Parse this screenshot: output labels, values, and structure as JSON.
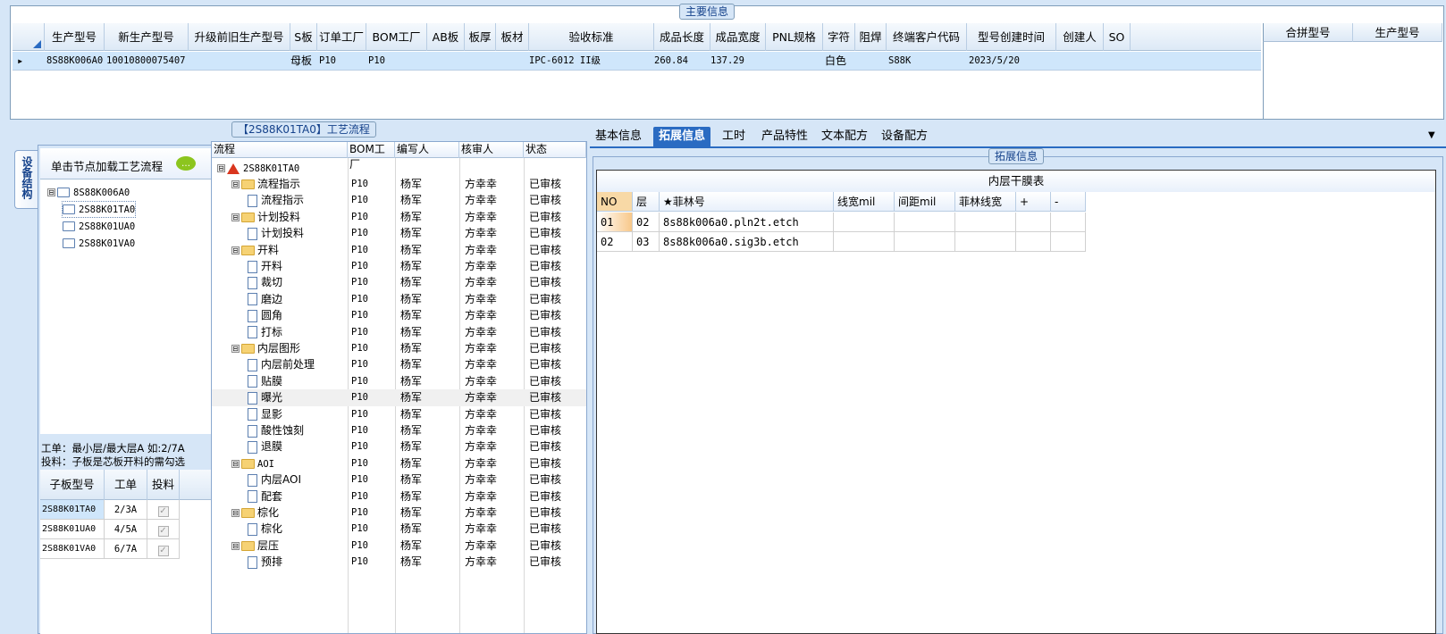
{
  "main_info": {
    "title": "主要信息",
    "headers": [
      "生产型号",
      "新生产型号",
      "升级前旧生产型号",
      "S板",
      "订单工厂",
      "BOM工厂",
      "AB板",
      "板厚",
      "板材",
      "验收标准",
      "成品长度",
      "成品宽度",
      "PNL规格",
      "字符",
      "阻焊",
      "终端客户代码",
      "型号创建时间",
      "创建人",
      "SO"
    ],
    "row": {
      "marker": "▸",
      "prod_model": "8S88K006A0",
      "new_model": "10010800075407",
      "old_model": "",
      "s_board": "母板",
      "order_factory": "P10",
      "bom_factory": "P10",
      "ab": "",
      "thickness": "",
      "material": "",
      "standard": "IPC-6012 II级",
      "length": "260.84",
      "width": "137.29",
      "pnl": "",
      "char": "白色",
      "mask": "",
      "customer": "S88K",
      "created": "2023/5/20",
      "creator": "",
      "so": ""
    },
    "merge_headers": [
      "合拼型号",
      "生产型号"
    ]
  },
  "left": {
    "vertical_tab": "设备结构",
    "click_hint": "单击节点加载工艺流程",
    "tree": [
      {
        "label": "8S88K006A0",
        "level": 0,
        "toggle": "⊟"
      },
      {
        "label": "2S88K01TA0",
        "level": 1,
        "selected": true
      },
      {
        "label": "2S88K01UA0",
        "level": 1
      },
      {
        "label": "2S88K01VA0",
        "level": 1
      }
    ],
    "note_line1": "工单：最小层/最大层A 如:2/7A",
    "note_line2": "投料：子板是芯板开料的需勾选",
    "sub_headers": [
      "子板型号",
      "工单",
      "投料"
    ],
    "sub_rows": [
      {
        "model": "2S88K01TA0",
        "order": "2/3A",
        "check": "✓"
      },
      {
        "model": "2S88K01UA0",
        "order": "4/5A",
        "check": "✓"
      },
      {
        "model": "2S88K01VA0",
        "order": "6/7A",
        "check": "✓"
      }
    ]
  },
  "process": {
    "title": "【2S88K01TA0】工艺流程",
    "headers": [
      "流程",
      "BOM工厂",
      "编写人",
      "核审人",
      "状态"
    ],
    "root": "2S88K01TA0",
    "rows": [
      {
        "name": "流程指示",
        "type": "group",
        "factory": "P10",
        "writer": "杨军",
        "reviewer": "方幸幸",
        "status": "已审核"
      },
      {
        "name": "流程指示",
        "type": "leaf",
        "factory": "P10",
        "writer": "杨军",
        "reviewer": "方幸幸",
        "status": "已审核"
      },
      {
        "name": "计划投料",
        "type": "group",
        "factory": "P10",
        "writer": "杨军",
        "reviewer": "方幸幸",
        "status": "已审核"
      },
      {
        "name": "计划投料",
        "type": "leaf",
        "factory": "P10",
        "writer": "杨军",
        "reviewer": "方幸幸",
        "status": "已审核"
      },
      {
        "name": "开料",
        "type": "group",
        "factory": "P10",
        "writer": "杨军",
        "reviewer": "方幸幸",
        "status": "已审核"
      },
      {
        "name": "开料",
        "type": "leaf",
        "factory": "P10",
        "writer": "杨军",
        "reviewer": "方幸幸",
        "status": "已审核"
      },
      {
        "name": "裁切",
        "type": "leaf",
        "factory": "P10",
        "writer": "杨军",
        "reviewer": "方幸幸",
        "status": "已审核"
      },
      {
        "name": "磨边",
        "type": "leaf",
        "factory": "P10",
        "writer": "杨军",
        "reviewer": "方幸幸",
        "status": "已审核"
      },
      {
        "name": "圆角",
        "type": "leaf",
        "factory": "P10",
        "writer": "杨军",
        "reviewer": "方幸幸",
        "status": "已审核"
      },
      {
        "name": "打标",
        "type": "leaf",
        "factory": "P10",
        "writer": "杨军",
        "reviewer": "方幸幸",
        "status": "已审核"
      },
      {
        "name": "内层图形",
        "type": "group",
        "factory": "P10",
        "writer": "杨军",
        "reviewer": "方幸幸",
        "status": "已审核"
      },
      {
        "name": "内层前处理",
        "type": "leaf",
        "factory": "P10",
        "writer": "杨军",
        "reviewer": "方幸幸",
        "status": "已审核"
      },
      {
        "name": "贴膜",
        "type": "leaf",
        "factory": "P10",
        "writer": "杨军",
        "reviewer": "方幸幸",
        "status": "已审核"
      },
      {
        "name": "曝光",
        "type": "leaf",
        "factory": "P10",
        "writer": "杨军",
        "reviewer": "方幸幸",
        "status": "已审核",
        "highlight": true
      },
      {
        "name": "显影",
        "type": "leaf",
        "factory": "P10",
        "writer": "杨军",
        "reviewer": "方幸幸",
        "status": "已审核"
      },
      {
        "name": "酸性蚀刻",
        "type": "leaf",
        "factory": "P10",
        "writer": "杨军",
        "reviewer": "方幸幸",
        "status": "已审核"
      },
      {
        "name": "退膜",
        "type": "leaf",
        "factory": "P10",
        "writer": "杨军",
        "reviewer": "方幸幸",
        "status": "已审核"
      },
      {
        "name": "AOI",
        "type": "group",
        "factory": "P10",
        "writer": "杨军",
        "reviewer": "方幸幸",
        "status": "已审核"
      },
      {
        "name": "内层AOI",
        "type": "leaf",
        "factory": "P10",
        "writer": "杨军",
        "reviewer": "方幸幸",
        "status": "已审核"
      },
      {
        "name": "配套",
        "type": "leaf",
        "factory": "P10",
        "writer": "杨军",
        "reviewer": "方幸幸",
        "status": "已审核"
      },
      {
        "name": "棕化",
        "type": "group",
        "factory": "P10",
        "writer": "杨军",
        "reviewer": "方幸幸",
        "status": "已审核"
      },
      {
        "name": "棕化",
        "type": "leaf",
        "factory": "P10",
        "writer": "杨军",
        "reviewer": "方幸幸",
        "status": "已审核"
      },
      {
        "name": "层压",
        "type": "group",
        "factory": "P10",
        "writer": "杨军",
        "reviewer": "方幸幸",
        "status": "已审核"
      },
      {
        "name": "预排",
        "type": "leaf",
        "factory": "P10",
        "writer": "杨军",
        "reviewer": "方幸幸",
        "status": "已审核"
      }
    ]
  },
  "right": {
    "tabs": [
      "基本信息",
      "拓展信息",
      "工时",
      "产品特性",
      "文本配方",
      "设备配方"
    ],
    "active_tab": 1,
    "dropdown": "▼",
    "group_title": "拓展信息",
    "table_title": "内层干膜表",
    "headers": [
      "NO",
      "层",
      "★菲林号",
      "线宽mil",
      "间距mil",
      "菲林线宽",
      "+",
      "-"
    ],
    "rows": [
      {
        "no": "01",
        "layer": "02",
        "film": "8s88k006a0.pln2t.etch"
      },
      {
        "no": "02",
        "layer": "03",
        "film": "8s88k006a0.sig3b.etch"
      }
    ]
  }
}
